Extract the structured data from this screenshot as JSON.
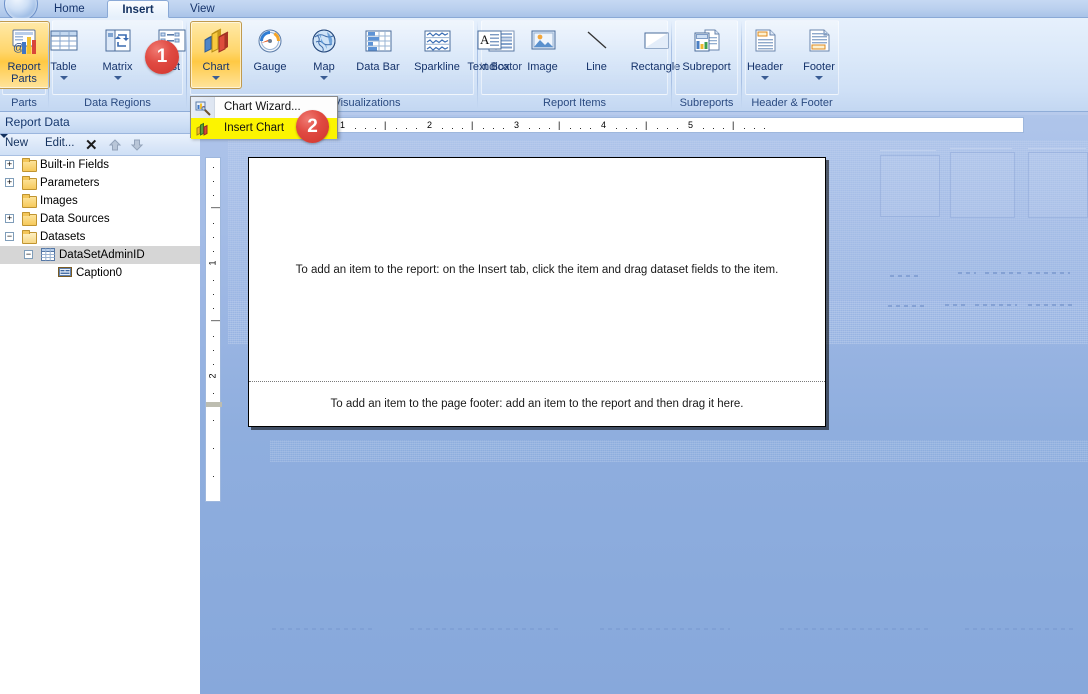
{
  "app": {
    "orb_icon": "office-orb-icon"
  },
  "tabs": [
    {
      "label": "Home",
      "name": "tab-home",
      "active": false
    },
    {
      "label": "Insert",
      "name": "tab-insert",
      "active": true
    },
    {
      "label": "View",
      "name": "tab-view",
      "active": false
    }
  ],
  "ribbon": {
    "groups": [
      {
        "label": "Parts",
        "buttons": [
          {
            "label": "Report Parts",
            "icon": "report-parts-icon",
            "state": "active",
            "caret": false
          }
        ]
      },
      {
        "label": "Data Regions",
        "buttons": [
          {
            "label": "Table",
            "icon": "table-icon",
            "caret": true
          },
          {
            "label": "Matrix",
            "icon": "matrix-icon",
            "caret": true
          },
          {
            "label": "List",
            "icon": "list-icon",
            "caret": false
          }
        ]
      },
      {
        "label": "Visualizations",
        "label_visible_part": "zations",
        "buttons": [
          {
            "label": "Chart",
            "icon": "chart-icon",
            "state": "active",
            "caret": true
          },
          {
            "label": "Gauge",
            "icon": "gauge-icon",
            "caret": false
          },
          {
            "label": "Map",
            "icon": "map-icon",
            "caret": true
          },
          {
            "label": "Data Bar",
            "icon": "data-bar-icon",
            "caret": false
          },
          {
            "label": "Sparkline",
            "icon": "sparkline-icon",
            "caret": false
          },
          {
            "label": "Indicator",
            "icon": "indicator-icon",
            "caret": false
          }
        ]
      },
      {
        "label": "Report Items",
        "buttons": [
          {
            "label": "Text Box",
            "icon": "text-box-icon",
            "caret": false
          },
          {
            "label": "Image",
            "icon": "image-icon",
            "caret": false
          },
          {
            "label": "Line",
            "icon": "line-icon",
            "caret": false
          },
          {
            "label": "Rectangle",
            "icon": "rectangle-icon",
            "caret": false
          }
        ]
      },
      {
        "label": "Subreports",
        "buttons": [
          {
            "label": "Subreport",
            "icon": "subreport-icon",
            "caret": false
          }
        ]
      },
      {
        "label": "Header & Footer",
        "buttons": [
          {
            "label": "Header",
            "icon": "header-icon",
            "caret": true
          },
          {
            "label": "Footer",
            "icon": "footer-icon",
            "caret": true
          }
        ]
      }
    ]
  },
  "chart_menu": {
    "items": [
      {
        "label": "Chart Wizard...",
        "icon": "chart-wizard-icon",
        "selected": false
      },
      {
        "label": "Insert Chart",
        "icon": "insert-chart-icon",
        "selected": true
      }
    ]
  },
  "report_data": {
    "title": "Report Data",
    "collapse_icon": "chevron-right-icon",
    "toolbar": {
      "new_label": "New",
      "new_caret_icon": "chevron-down-icon",
      "edit_label": "Edit...",
      "delete_icon": "close-x-icon",
      "move_up_icon": "arrow-up-icon",
      "move_down_icon": "arrow-down-icon"
    },
    "tree": [
      {
        "label": "Built-in Fields",
        "icon": "folder-icon",
        "expander": "+",
        "indent": 1,
        "selected": false
      },
      {
        "label": "Parameters",
        "icon": "folder-icon",
        "expander": "+",
        "indent": 1,
        "selected": false
      },
      {
        "label": "Images",
        "icon": "folder-icon",
        "expander": "",
        "indent": 1,
        "selected": false
      },
      {
        "label": "Data Sources",
        "icon": "folder-icon",
        "expander": "+",
        "indent": 1,
        "selected": false
      },
      {
        "label": "Datasets",
        "icon": "folder-open-icon",
        "expander": "−",
        "indent": 1,
        "selected": false
      },
      {
        "label": "DataSetAdminID",
        "icon": "dataset-icon",
        "expander": "−",
        "indent": 2,
        "selected": true
      },
      {
        "label": "Caption0",
        "icon": "field-icon",
        "expander": "",
        "indent": 3,
        "selected": false
      }
    ]
  },
  "design": {
    "h_ruler_ticks": [
      "1",
      "2",
      "3",
      "4",
      "5"
    ],
    "v_ruler_ticks": [
      "1",
      "2"
    ],
    "body_hint": "To add an item to the report: on the Insert tab, click the item and drag dataset fields to the item.",
    "footer_hint": "To add an item to the page footer: add an item to the report and then drag it here."
  },
  "callouts": [
    {
      "number": "1",
      "name": "callout-badge-1"
    },
    {
      "number": "2",
      "name": "callout-badge-2"
    }
  ],
  "colors": {
    "accent": "#ffc944",
    "menu_highlight": "#fcf400",
    "badge": "#d0342c",
    "ribbon_bg": "#dae8f9",
    "canvas_bg": "#9db7e4"
  }
}
